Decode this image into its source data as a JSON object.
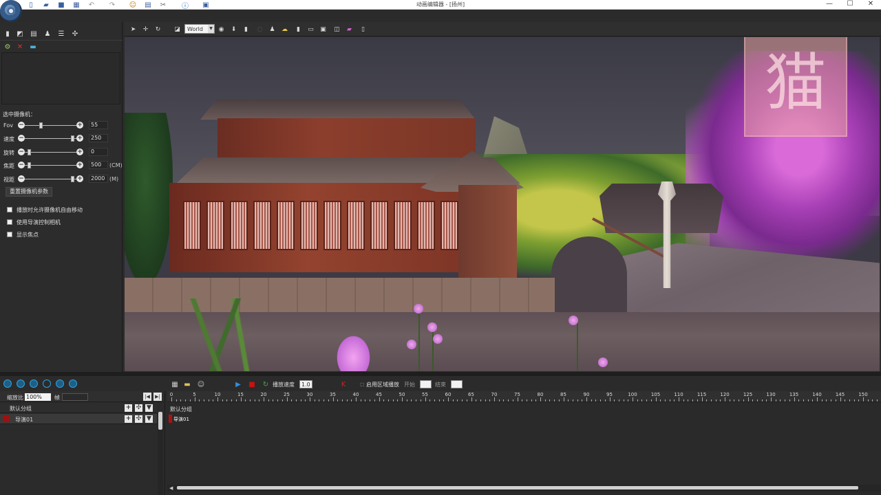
{
  "window": {
    "title": "动画编辑器 - [扬州]",
    "minimize": "—",
    "maximize": "☐",
    "close": "✕"
  },
  "quick_access": [
    "document-icon",
    "open-folder-icon",
    "save-icon",
    "print-icon",
    "undo-icon",
    "redo-icon",
    "people-icon",
    "grid-icon",
    "tools-icon",
    "info-icon",
    "window-icon"
  ],
  "viewport_toolbar": {
    "space_select": "World"
  },
  "left_panel": {
    "selected_camera_label": "选中摄像机：",
    "sliders": [
      {
        "label": "Fov",
        "value": "55",
        "unit": "",
        "pos": 0.3
      },
      {
        "label": "速度",
        "value": "250",
        "unit": "",
        "pos": 0.95
      },
      {
        "label": "旋转",
        "value": "0",
        "unit": "",
        "pos": 0.05
      },
      {
        "label": "焦距",
        "value": "500",
        "unit": "(CM)",
        "pos": 0.05
      },
      {
        "label": "视距",
        "value": "2000",
        "unit": "(M)",
        "pos": 0.95
      }
    ],
    "reset_button": "重置摄像机参数",
    "checkboxes": [
      {
        "label": "播放时允许摄像机自由移动",
        "checked": false
      },
      {
        "label": "使用导演控制相机",
        "checked": false
      },
      {
        "label": "显示焦点",
        "checked": false
      }
    ]
  },
  "viewport": {
    "seal_text": "猫"
  },
  "timeline_toolbar": {
    "play_speed_label": "播放速度",
    "play_speed_value": "1.0",
    "enable_region_label": "启用区域播放",
    "start_label": "开始",
    "end_label": "结束",
    "start_value": "",
    "end_value": ""
  },
  "track_panel": {
    "zoom_label": "缩放比",
    "zoom_value": "100%",
    "frame_label": "帧",
    "frame_value": "",
    "rows": [
      {
        "name": "默认分组",
        "selected": false,
        "color": ""
      },
      {
        "name": "导演01",
        "selected": true,
        "color": "#a01010"
      }
    ]
  },
  "timeline": {
    "ticks": [
      0,
      5,
      10,
      15,
      20,
      25,
      30,
      35,
      40,
      45,
      50,
      55,
      60,
      65,
      70,
      75,
      80,
      85,
      90,
      95,
      100,
      105,
      110,
      115,
      120,
      125,
      130,
      135,
      140,
      145,
      150
    ],
    "group_label": "默认分组",
    "clip_label": "导演01"
  },
  "colors": {
    "panel_bg": "#2c2c2c",
    "accent_blue": "#2fa0e0",
    "record_red": "#cc1111",
    "track_red": "#a01010"
  }
}
